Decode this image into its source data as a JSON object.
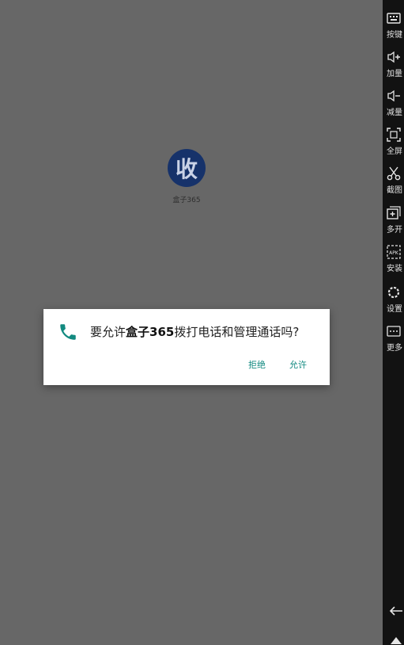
{
  "app": {
    "icon_char": "收",
    "label": "盒子365"
  },
  "dialog": {
    "prefix": "要允许",
    "app_name": "盒子365",
    "suffix": "拨打电话和管理通话吗?",
    "deny_label": "拒绝",
    "allow_label": "允许",
    "icon": "phone-icon",
    "accent_color": "#128a80"
  },
  "toolbar": {
    "items": [
      {
        "label": "按键",
        "icon": "keyboard-icon"
      },
      {
        "label": "加量",
        "icon": "volume-up-icon"
      },
      {
        "label": "减量",
        "icon": "volume-down-icon"
      },
      {
        "label": "全屏",
        "icon": "fullscreen-icon"
      },
      {
        "label": "截图",
        "icon": "scissors-icon"
      },
      {
        "label": "多开",
        "icon": "multi-instance-icon"
      },
      {
        "label": "安装",
        "icon": "apk-install-icon"
      },
      {
        "label": "设置",
        "icon": "gear-icon"
      },
      {
        "label": "更多",
        "icon": "more-icon"
      }
    ]
  }
}
